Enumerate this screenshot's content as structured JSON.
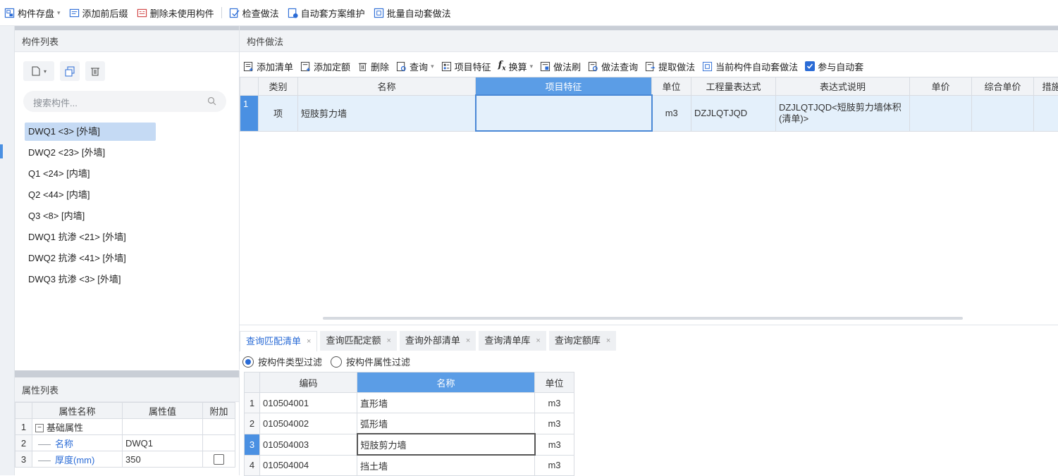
{
  "toolbar": {
    "items": [
      {
        "label": "构件存盘",
        "icon": "save-component-icon",
        "caret": "▾"
      },
      {
        "label": "添加前后缀",
        "icon": "add-prefix-icon"
      },
      {
        "label": "删除未使用构件",
        "icon": "delete-unused-icon"
      },
      {
        "label": "检查做法",
        "icon": "check-method-icon"
      },
      {
        "label": "自动套方案维护",
        "icon": "auto-scheme-icon"
      },
      {
        "label": "批量自动套做法",
        "icon": "batch-auto-icon"
      }
    ]
  },
  "component_list": {
    "title": "构件列表",
    "search_placeholder": "搜索构件...",
    "items": [
      {
        "label": "DWQ1 <3> [外墙]",
        "selected": true
      },
      {
        "label": "DWQ2 <23> [外墙]"
      },
      {
        "label": "Q1 <24> [内墙]"
      },
      {
        "label": "Q2 <44> [内墙]"
      },
      {
        "label": "Q3 <8> [内墙]"
      },
      {
        "label": "DWQ1  抗渗 <21> [外墙]"
      },
      {
        "label": "DWQ2  抗渗 <41> [外墙]"
      },
      {
        "label": "DWQ3  抗渗 <3> [外墙]"
      }
    ]
  },
  "properties": {
    "title": "属性列表",
    "headers": [
      "属性名称",
      "属性值",
      "附加"
    ],
    "rows": [
      {
        "num": "1",
        "name": "基础属性",
        "value": "",
        "expander": "−"
      },
      {
        "num": "2",
        "name": "名称",
        "value": "DWQ1"
      },
      {
        "num": "3",
        "name": "厚度(mm)",
        "value": "350"
      }
    ]
  },
  "method": {
    "title": "构件做法",
    "tools": [
      {
        "label": "添加清单",
        "icon": "add-list-icon"
      },
      {
        "label": "添加定额",
        "icon": "add-quota-icon"
      },
      {
        "label": "删除",
        "icon": "delete-icon"
      },
      {
        "label": "查询",
        "icon": "query-icon",
        "caret": "▾"
      },
      {
        "label": "项目特征",
        "icon": "item-feature-icon"
      },
      {
        "label": "换算",
        "icon": "fx-icon",
        "caret": "▾"
      },
      {
        "label": "做法刷",
        "icon": "method-brush-icon"
      },
      {
        "label": "做法查询",
        "icon": "method-query-icon"
      },
      {
        "label": "提取做法",
        "icon": "extract-method-icon"
      },
      {
        "label": "当前构件自动套做法",
        "icon": "auto-apply-icon"
      }
    ],
    "checkbox_label": "参与自动套",
    "headers": [
      "",
      "类别",
      "名称",
      "项目特征",
      "单位",
      "工程量表达式",
      "表达式说明",
      "单价",
      "综合单价",
      "措施"
    ],
    "rows": [
      {
        "num": "1",
        "category": "项",
        "name": "短肢剪力墙",
        "feature": "",
        "unit": "m3",
        "expr": "DZJLQTJQD",
        "desc": "DZJLQTJQD<短肢剪力墙体积(清单)>",
        "price": "",
        "total": "",
        "measure": ""
      }
    ]
  },
  "query": {
    "tabs": [
      {
        "label": "查询匹配清单",
        "active": true
      },
      {
        "label": "查询匹配定额"
      },
      {
        "label": "查询外部清单"
      },
      {
        "label": "查询清单库"
      },
      {
        "label": "查询定额库"
      }
    ],
    "close_glyph": "×",
    "filters": [
      {
        "label": "按构件类型过滤",
        "checked": true
      },
      {
        "label": "按构件属性过滤",
        "checked": false
      }
    ],
    "headers": [
      "",
      "编码",
      "名称",
      "单位"
    ],
    "rows": [
      {
        "num": "1",
        "code": "010504001",
        "name": "直形墙",
        "unit": "m3"
      },
      {
        "num": "2",
        "code": "010504002",
        "name": "弧形墙",
        "unit": "m3"
      },
      {
        "num": "3",
        "code": "010504003",
        "name": "短肢剪力墙",
        "unit": "m3",
        "selected": true
      },
      {
        "num": "4",
        "code": "010504004",
        "name": "挡土墙",
        "unit": "m3"
      }
    ]
  }
}
